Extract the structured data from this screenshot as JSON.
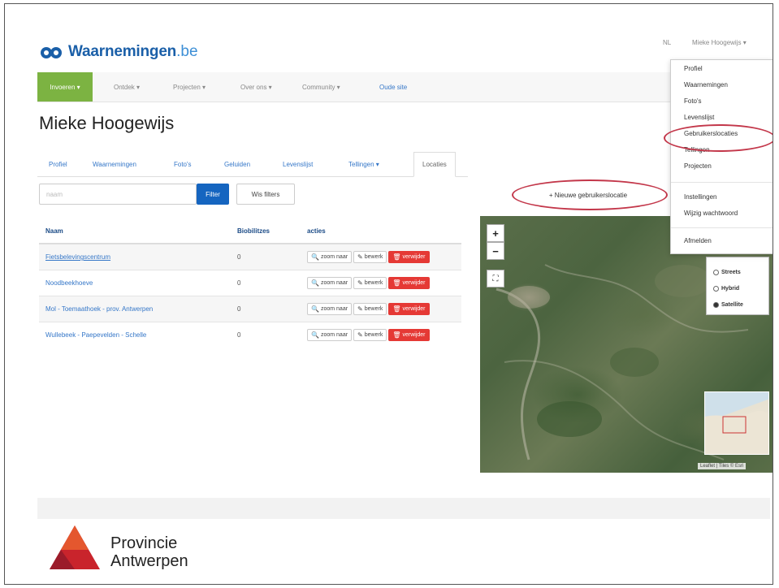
{
  "header": {
    "brand": "Waarnemingen",
    "brand_tld": ".be",
    "lang": "NL",
    "user": "Mieke Hoogewijs ▾"
  },
  "nav": {
    "explore": "Invoeren ▾",
    "items": [
      "Ontdek ▾",
      "Projecten ▾",
      "Over ons ▾",
      "Community ▾"
    ],
    "old_site": "Oude site"
  },
  "page_title": "Mieke Hoogewijs",
  "tabs": [
    "Profiel",
    "Waarnemingen",
    "Foto's",
    "Geluiden",
    "Levenslijst",
    "Tellingen ▾",
    "Locaties"
  ],
  "filter": {
    "placeholder": "naam",
    "filter_btn": "Filter",
    "clear_btn": "Wis filters"
  },
  "new_location_btn": "+ Nieuwe gebruikerslocatie",
  "table": {
    "headers": [
      "Naam",
      "Biobilitzes",
      "acties"
    ],
    "rows": [
      {
        "name": "Fietsbelevingscentrum",
        "count": "0"
      },
      {
        "name": "Noodbeekhoeve",
        "count": "0"
      },
      {
        "name": "Mol - Toemaathoek - prov. Antwerpen",
        "count": "0"
      },
      {
        "name": "Wullebeek - Paepevelden - Schelle",
        "count": "0"
      }
    ],
    "actions": {
      "zoom": "zoom naar",
      "edit": "bewerk",
      "delete": "verwijder"
    }
  },
  "map": {
    "zoom_in": "+",
    "zoom_out": "−",
    "layers": [
      "Streets",
      "Hybrid",
      "Satellite"
    ],
    "selected_layer": "Satellite",
    "attribution": "Leaflet | Tiles © Esri"
  },
  "dropdown": {
    "group1": [
      "Profiel",
      "Waarnemingen",
      "Foto's",
      "Levenslijst",
      "Gebruikerslocaties",
      "Tellingen",
      "Projecten"
    ],
    "group2": [
      "Instellingen",
      "Wijzig wachtwoord"
    ],
    "group3": [
      "Afmelden"
    ]
  },
  "footer": {
    "org_line1": "Provincie",
    "org_line2": "Antwerpen"
  },
  "colors": {
    "brand_blue": "#1a5fa8",
    "explore_green": "#7cb342",
    "filter_blue": "#1565c0",
    "delete_red": "#e53935",
    "annotation_red": "#c3374a",
    "link_blue": "#3577c8"
  }
}
